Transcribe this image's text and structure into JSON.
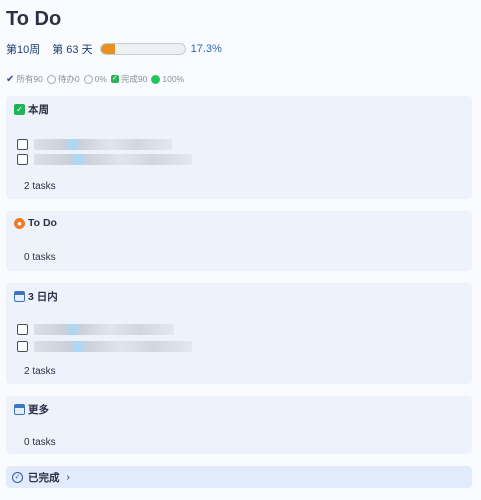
{
  "app": {
    "title": "To Do"
  },
  "progress": {
    "week_label": "第10周",
    "day_label": "第 63 天",
    "fraction": 0.173,
    "percent_text": "17.3%",
    "bar_color": "#e6911e"
  },
  "filters": [
    {
      "label": "所有90",
      "icon": "check-icon"
    },
    {
      "label": "待办0",
      "icon": "radio-icon"
    },
    {
      "label": "0%",
      "icon": "radio-icon"
    },
    {
      "label": "完成90",
      "icon": "checkbox-icon"
    },
    {
      "label": "100%",
      "icon": "green-dot-icon",
      "color": "#22c55e"
    }
  ],
  "sections": [
    {
      "name": "本周",
      "icon": "green-check-icon",
      "count_text": "2 tasks"
    },
    {
      "name": "To Do",
      "icon": "fox-icon",
      "count_text": "0 tasks"
    },
    {
      "name": "3 日内",
      "icon": "calendar-icon",
      "count_text": "2 tasks"
    },
    {
      "name": "更多",
      "icon": "calendar-icon",
      "count_text": "0 tasks"
    }
  ],
  "completed": {
    "label": "已完成",
    "icon": "circle-check-icon",
    "chevron": "›"
  }
}
